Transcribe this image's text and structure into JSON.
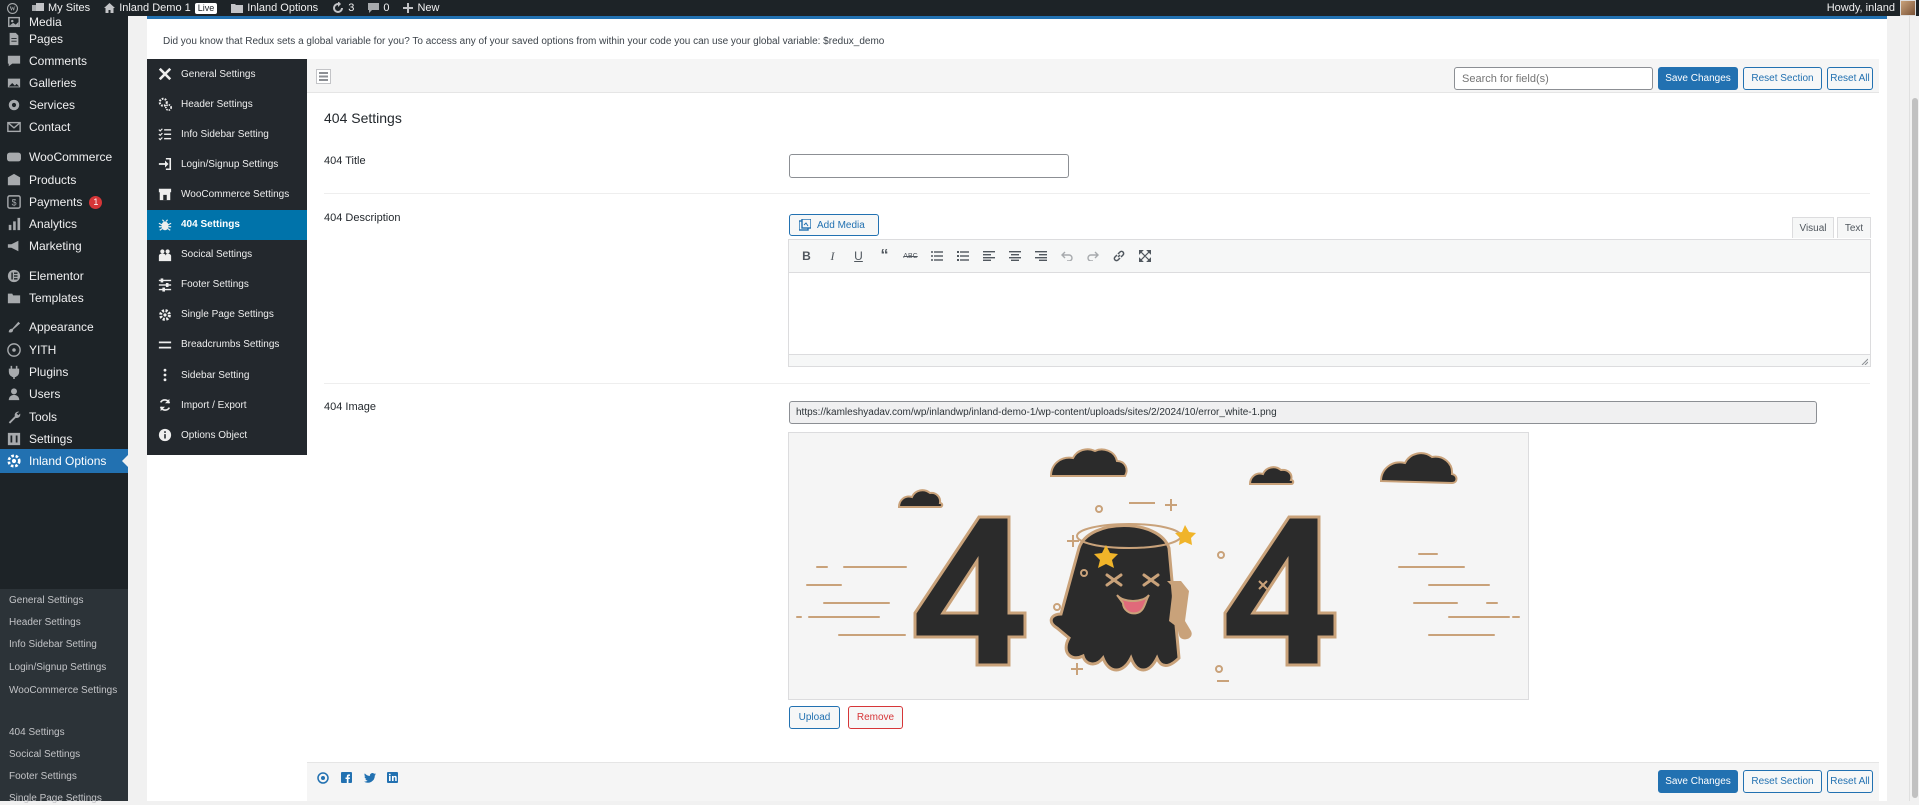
{
  "admin_bar": {
    "my_sites": "My Sites",
    "site_name": "Inland Demo 1",
    "live_badge": "Live",
    "options_link": "Inland Options",
    "updates_count": "3",
    "comments_count": "0",
    "new_label": "New",
    "howdy": "Howdy, inland"
  },
  "admin_menu": {
    "items": [
      {
        "label": "Media",
        "icon": "media-icon"
      },
      {
        "label": "Pages",
        "icon": "pages-icon"
      },
      {
        "label": "Comments",
        "icon": "comments-icon"
      },
      {
        "label": "Galleries",
        "icon": "galleries-icon"
      },
      {
        "label": "Services",
        "icon": "services-icon"
      },
      {
        "label": "Contact",
        "icon": "contact-icon"
      },
      {
        "label": "WooCommerce",
        "icon": "woocommerce-icon"
      },
      {
        "label": "Products",
        "icon": "products-icon"
      },
      {
        "label": "Payments",
        "icon": "payments-icon",
        "badge": "1"
      },
      {
        "label": "Analytics",
        "icon": "analytics-icon"
      },
      {
        "label": "Marketing",
        "icon": "marketing-icon"
      },
      {
        "label": "Elementor",
        "icon": "elementor-icon"
      },
      {
        "label": "Templates",
        "icon": "templates-icon"
      },
      {
        "label": "Appearance",
        "icon": "appearance-icon"
      },
      {
        "label": "YITH",
        "icon": "yith-icon"
      },
      {
        "label": "Plugins",
        "icon": "plugins-icon"
      },
      {
        "label": "Users",
        "icon": "users-icon"
      },
      {
        "label": "Tools",
        "icon": "tools-icon"
      },
      {
        "label": "Settings",
        "icon": "settings-icon"
      },
      {
        "label": "Inland Options",
        "icon": "inland-options-icon",
        "active": true
      }
    ],
    "submenu": [
      "General Settings",
      "Header Settings",
      "Info Sidebar Setting",
      "Login/Signup Settings",
      "WooCommerce Settings",
      "404 Settings",
      "Socical Settings",
      "Footer Settings",
      "Single Page Settings"
    ]
  },
  "notice": "Did you know that Redux sets a global variable for you? To access any of your saved options from within your code you can use your global variable: $redux_demo",
  "options_nav": [
    {
      "label": "General Settings",
      "icon": "tools-cross-icon"
    },
    {
      "label": "Header Settings",
      "icon": "gears-icon"
    },
    {
      "label": "Info Sidebar Setting",
      "icon": "list-icon"
    },
    {
      "label": "Login/Signup Settings",
      "icon": "sign-in-icon"
    },
    {
      "label": "WooCommerce Settings",
      "icon": "store-icon"
    },
    {
      "label": "404 Settings",
      "icon": "bug-icon",
      "active": true
    },
    {
      "label": "Socical Settings",
      "icon": "people-icon"
    },
    {
      "label": "Footer Settings",
      "icon": "sliders-icon"
    },
    {
      "label": "Single Page Settings",
      "icon": "gear-icon"
    },
    {
      "label": "Breadcrumbs Settings",
      "icon": "breadcrumbs-icon"
    },
    {
      "label": "Sidebar Setting",
      "icon": "vertical-dots-icon"
    },
    {
      "label": "Import / Export",
      "icon": "refresh-icon"
    },
    {
      "label": "Options Object",
      "icon": "info-icon"
    }
  ],
  "toolbar": {
    "search_placeholder": "Search for field(s)",
    "save_label": "Save Changes",
    "reset_section_label": "Reset Section",
    "reset_all_label": "Reset All"
  },
  "section": {
    "title": "404 Settings",
    "title_field_label": "404 Title",
    "title_field_value": "",
    "description_label": "404 Description",
    "add_media_label": "Add Media",
    "visual_tab": "Visual",
    "text_tab": "Text",
    "image_label": "404 Image",
    "image_url": "https://kamleshyadav.com/wp/inlandwp/inland-demo-1/wp-content/uploads/sites/2/2024/10/error_white-1.png",
    "upload_label": "Upload",
    "remove_label": "Remove"
  },
  "colors": {
    "accent": "#2271b1",
    "admin_dark": "#1d2327",
    "nav_dark": "#23282d",
    "nav_active": "#0073aa",
    "badge": "#d63638",
    "remove_red": "#d63638"
  }
}
